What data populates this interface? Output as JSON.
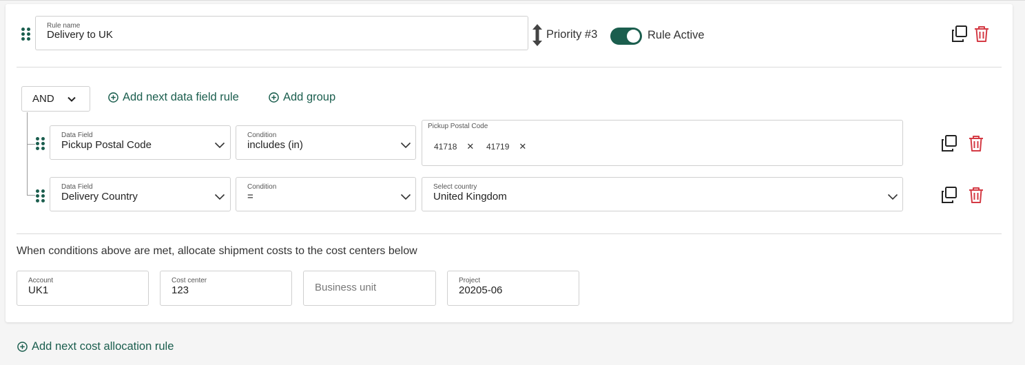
{
  "rule": {
    "name_label": "Rule name",
    "name_value": "Delivery to UK",
    "priority": "Priority #3",
    "active_label": "Rule Active",
    "active": true
  },
  "logic": {
    "operator": "AND",
    "add_field_rule": "Add next data field rule",
    "add_group": "Add group"
  },
  "conditions": [
    {
      "field_label": "Data Field",
      "field_value": "Pickup Postal Code",
      "cond_label": "Condition",
      "cond_value": "includes (in)",
      "value_label": "Pickup Postal Code",
      "chips": [
        "41718",
        "41719"
      ]
    },
    {
      "field_label": "Data Field",
      "field_value": "Delivery Country",
      "cond_label": "Condition",
      "cond_value": "=",
      "value_label": "Select country",
      "value_value": "United Kingdom"
    }
  ],
  "allocation": {
    "heading": "When conditions above are met, allocate shipment costs to the cost centers below",
    "account_label": "Account",
    "account_value": "UK1",
    "cost_center_label": "Cost center",
    "cost_center_value": "123",
    "business_unit_placeholder": "Business unit",
    "project_label": "Project",
    "project_value": "20205-06"
  },
  "footer": {
    "add_cost_rule": "Add next cost allocation rule"
  },
  "colors": {
    "accent": "#1b5e4e",
    "danger": "#d43a44"
  },
  "icons": {
    "drag": "drag-handle-icon",
    "priority": "up-down-arrow-icon",
    "copy": "copy-icon",
    "delete": "trash-icon",
    "add": "plus-circle-icon",
    "dropdown": "chevron-down-icon",
    "remove": "close-icon"
  }
}
